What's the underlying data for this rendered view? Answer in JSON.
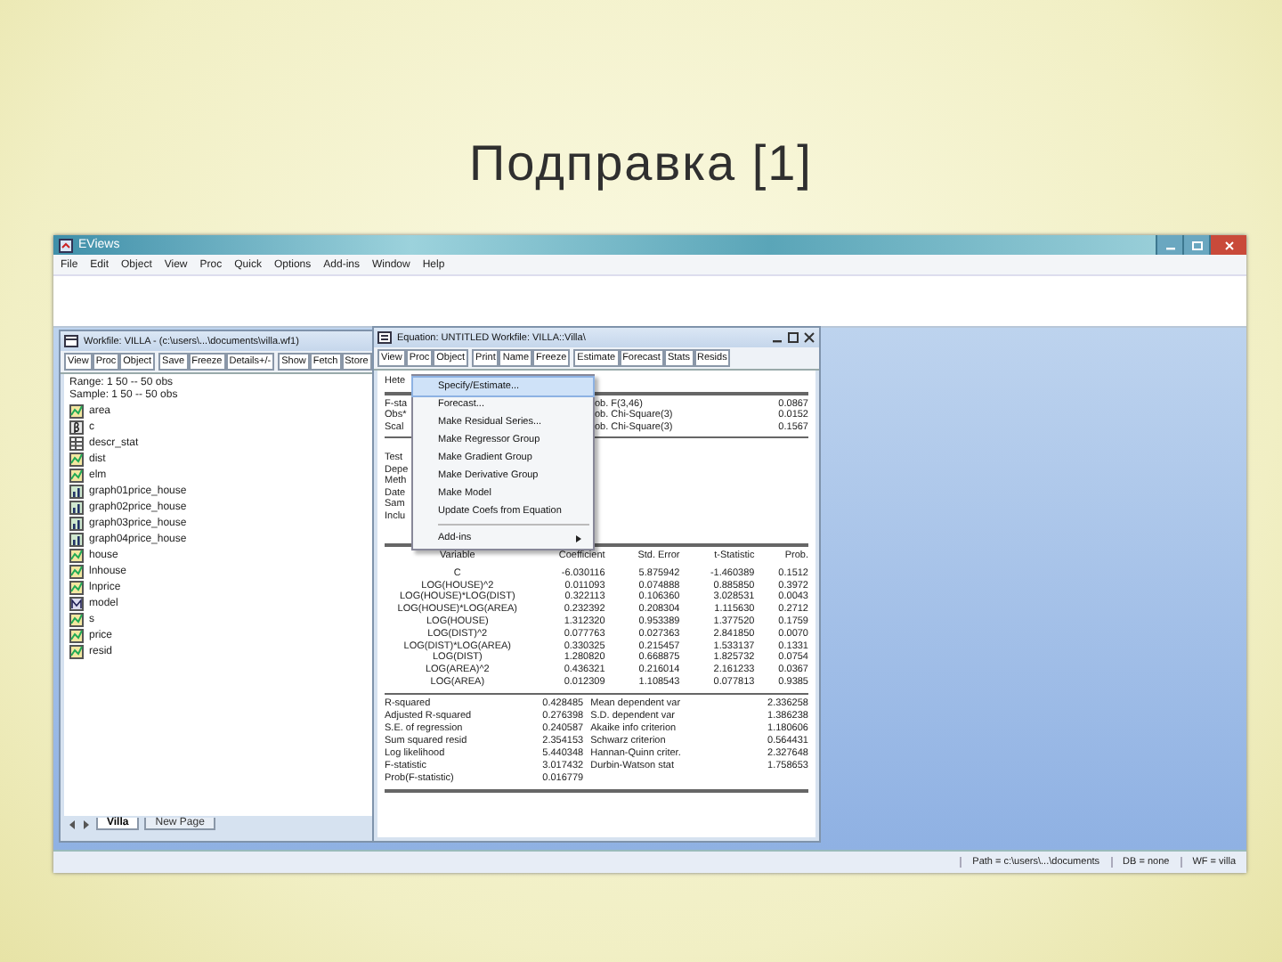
{
  "slide": {
    "title": "Подправка [1]"
  },
  "app": {
    "title": "EViews",
    "menu": [
      "File",
      "Edit",
      "Object",
      "View",
      "Proc",
      "Quick",
      "Options",
      "Add-ins",
      "Window",
      "Help"
    ],
    "status_bar": [
      "Path = c:\\users\\...\\documents",
      "DB = none",
      "WF = villa"
    ]
  },
  "workfile": {
    "title": "Workfile: VILLA - (c:\\users\\...\\documents\\villa.wf1)",
    "toolbar": [
      [
        "View",
        "Proc",
        "Object"
      ],
      [
        "Save",
        "Freeze",
        "Details+/-"
      ],
      [
        "Show",
        "Fetch",
        "Store"
      ]
    ],
    "range": "Range:  1 50  --  50 obs",
    "sample": "Sample: 1 50  --  50 obs",
    "items": [
      {
        "name": "area",
        "kind": "series"
      },
      {
        "name": "c",
        "kind": "coef"
      },
      {
        "name": "descr_stat",
        "kind": "table"
      },
      {
        "name": "dist",
        "kind": "series"
      },
      {
        "name": "elm",
        "kind": "series"
      },
      {
        "name": "graph01price_house",
        "kind": "graph"
      },
      {
        "name": "graph02price_house",
        "kind": "graph"
      },
      {
        "name": "graph03price_house",
        "kind": "graph"
      },
      {
        "name": "graph04price_house",
        "kind": "graph"
      },
      {
        "name": "house",
        "kind": "series"
      },
      {
        "name": "lnhouse",
        "kind": "series"
      },
      {
        "name": "lnprice",
        "kind": "series"
      },
      {
        "name": "model",
        "kind": "model"
      },
      {
        "name": "s",
        "kind": "series"
      },
      {
        "name": "price",
        "kind": "series"
      },
      {
        "name": "resid",
        "kind": "series"
      }
    ],
    "tabs": [
      {
        "label": "Villa",
        "selected": true
      },
      {
        "label": "New Page",
        "selected": false
      }
    ]
  },
  "equation": {
    "title": "Equation: UNTITLED   Workfile: VILLA::Villa\\",
    "toolbar": [
      [
        "View",
        "Proc",
        "Object"
      ],
      [
        "Print",
        "Name",
        "Freeze"
      ],
      [
        "Estimate",
        "Forecast",
        "Stats",
        "Resids"
      ]
    ],
    "menu": [
      {
        "kind": "item",
        "label": "Specify/Estimate...",
        "selected": true,
        "submenu": false
      },
      {
        "kind": "item",
        "label": "Forecast...",
        "selected": false,
        "submenu": false
      },
      {
        "kind": "item",
        "label": "Make Residual Series...",
        "selected": false,
        "submenu": false
      },
      {
        "kind": "item",
        "label": "Make Regressor Group",
        "selected": false,
        "submenu": false
      },
      {
        "kind": "item",
        "label": "Make Gradient Group",
        "selected": false,
        "submenu": false
      },
      {
        "kind": "item",
        "label": "Make Derivative Group",
        "selected": false,
        "submenu": false
      },
      {
        "kind": "item",
        "label": "Make Model",
        "selected": false,
        "submenu": false
      },
      {
        "kind": "item",
        "label": "Update Coefs from Equation",
        "selected": false,
        "submenu": false
      },
      {
        "kind": "separator"
      },
      {
        "kind": "item",
        "label": "Add-ins",
        "selected": false,
        "submenu": true
      }
    ],
    "test_title": "Hete",
    "test_rows": [
      {
        "label": "F-sta",
        "prob": "ob. F(3,46)",
        "value": "0.0867"
      },
      {
        "label": "Obs*",
        "prob": "ob. Chi-Square(3)",
        "value": "0.0152"
      },
      {
        "label": "Scal",
        "prob": "ob. Chi-Square(3)",
        "value": "0.1567"
      }
    ],
    "info_lines": [
      "Test",
      "Depe",
      "Meth",
      "Date",
      "Sam",
      "Inclu"
    ],
    "table": {
      "columns": [
        "Variable",
        "Coefficient",
        "Std. Error",
        "t-Statistic",
        "Prob."
      ],
      "rows": [
        [
          "C",
          "-6.030116",
          "5.875942",
          "-1.460389",
          "0.1512"
        ],
        [
          "LOG(HOUSE)^2",
          "0.011093",
          "0.074888",
          "0.885850",
          "0.3972"
        ],
        [
          "LOG(HOUSE)*LOG(DIST)",
          "0.322113",
          "0.106360",
          "3.028531",
          "0.0043"
        ],
        [
          "LOG(HOUSE)*LOG(AREA)",
          "0.232392",
          "0.208304",
          "1.115630",
          "0.2712"
        ],
        [
          "LOG(HOUSE)",
          "1.312320",
          "0.953389",
          "1.377520",
          "0.1759"
        ],
        [
          "LOG(DIST)^2",
          "0.077763",
          "0.027363",
          "2.841850",
          "0.0070"
        ],
        [
          "LOG(DIST)*LOG(AREA)",
          "0.330325",
          "0.215457",
          "1.533137",
          "0.1331"
        ],
        [
          "LOG(DIST)",
          "1.280820",
          "0.668875",
          "1.825732",
          "0.0754"
        ],
        [
          "LOG(AREA)^2",
          "0.436321",
          "0.216014",
          "2.161233",
          "0.0367"
        ],
        [
          "LOG(AREA)",
          "0.012309",
          "1.108543",
          "0.077813",
          "0.9385"
        ]
      ]
    },
    "stats": [
      [
        "R-squared",
        "0.428485",
        "Mean dependent var",
        "2.336258"
      ],
      [
        "Adjusted R-squared",
        "0.276398",
        "S.D. dependent var",
        "1.386238"
      ],
      [
        "S.E. of regression",
        "0.240587",
        "Akaike info criterion",
        "1.180606"
      ],
      [
        "Sum squared resid",
        "2.354153",
        "Schwarz criterion",
        "0.564431"
      ],
      [
        "Log likelihood",
        "5.440348",
        "Hannan-Quinn criter.",
        "2.327648"
      ],
      [
        "F-statistic",
        "3.017432",
        "Durbin-Watson stat",
        "1.758653"
      ],
      [
        "Prob(F-statistic)",
        "0.016779"
      ]
    ]
  }
}
